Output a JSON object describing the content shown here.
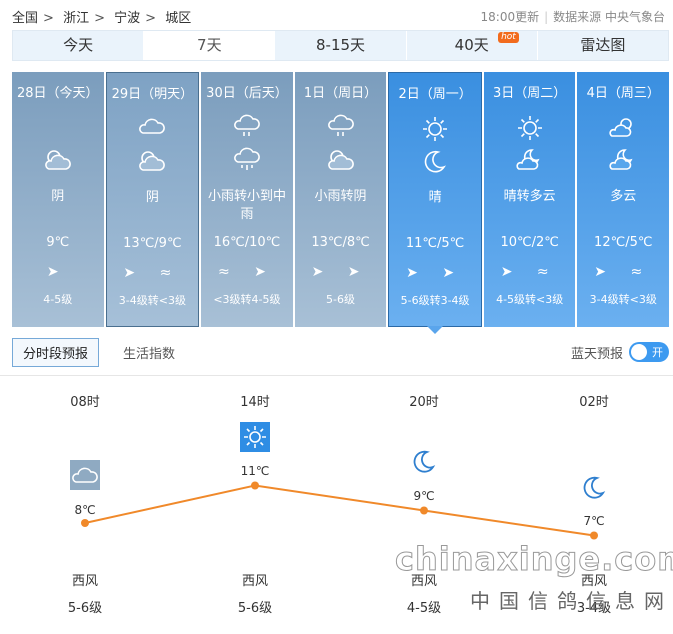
{
  "breadcrumb": [
    "全国",
    "浙江",
    "宁波",
    "城区"
  ],
  "update_time": "18:00更新",
  "source": "数据来源 中央气象台",
  "tabs": [
    {
      "label": "今天"
    },
    {
      "label": "7天"
    },
    {
      "label": "8-15天"
    },
    {
      "label": "40天",
      "badge": "hot"
    },
    {
      "label": "雷达图"
    }
  ],
  "days": [
    {
      "title": "28日（今天）",
      "desc": "阴",
      "temp": "9℃",
      "wind": "➤",
      "level": "4-5级"
    },
    {
      "title": "29日（明天）",
      "desc": "阴",
      "temp": "13℃/9℃",
      "wind": "➤ ≈",
      "level": "3-4级转<3级"
    },
    {
      "title": "30日（后天）",
      "desc": "小雨转小到中雨",
      "temp": "16℃/10℃",
      "wind": "≈ ➤",
      "level": "<3级转4-5级"
    },
    {
      "title": "1日（周日）",
      "desc": "小雨转阴",
      "temp": "13℃/8℃",
      "wind": "➤ ➤",
      "level": "5-6级"
    },
    {
      "title": "2日（周一）",
      "desc": "晴",
      "temp": "11℃/5℃",
      "wind": "➤ ➤",
      "level": "5-6级转3-4级"
    },
    {
      "title": "3日（周二）",
      "desc": "晴转多云",
      "temp": "10℃/2℃",
      "wind": "➤ ≈",
      "level": "4-5级转<3级"
    },
    {
      "title": "4日（周三）",
      "desc": "多云",
      "temp": "12℃/5℃",
      "wind": "➤ ≈",
      "level": "3-4级转<3级"
    }
  ],
  "sub_tabs": [
    {
      "label": "分时段预报"
    },
    {
      "label": "生活指数"
    }
  ],
  "toggle": {
    "label": "蓝天预报",
    "state": "开"
  },
  "hourly": [
    {
      "time": "08时",
      "temp": "8℃",
      "temp_value": 8,
      "wind": "西风",
      "level": "5-6级",
      "icon": "cloudy"
    },
    {
      "time": "14时",
      "temp": "11℃",
      "temp_value": 11,
      "wind": "西风",
      "level": "5-6级",
      "icon": "sun"
    },
    {
      "time": "20时",
      "temp": "9℃",
      "temp_value": 9,
      "wind": "西风",
      "level": "4-5级",
      "icon": "moon"
    },
    {
      "time": "02时",
      "temp": "7℃",
      "temp_value": 7,
      "wind": "西风",
      "level": "3-4级",
      "icon": "moon"
    }
  ],
  "watermark": {
    "site": "chinaxinge.com",
    "cn": "中国信鸽信息网"
  },
  "colors": {
    "line": "#f0892a",
    "selected_day": "#3a8fe0"
  }
}
